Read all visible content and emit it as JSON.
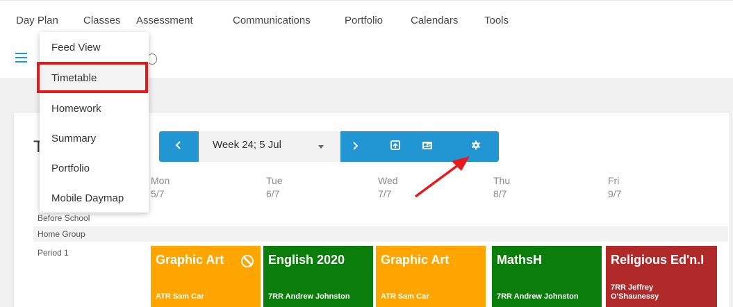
{
  "top_nav": [
    "Day Plan",
    "Classes",
    "Assessment",
    "Communications",
    "Portfolio",
    "Calendars",
    "Tools"
  ],
  "menu": {
    "items": [
      "Feed View",
      "Timetable",
      "Homework",
      "Summary",
      "Portfolio",
      "Mobile Daymap"
    ],
    "highlighted": "Timetable"
  },
  "card": {
    "title_fragment": "T"
  },
  "week_bar": {
    "selected_week": "Week 24; 5 Jul",
    "accent": "#2196d3"
  },
  "days": [
    {
      "name": "Mon",
      "date": "5/7"
    },
    {
      "name": "Tue",
      "date": "6/7"
    },
    {
      "name": "Wed",
      "date": "7/7"
    },
    {
      "name": "Thu",
      "date": "8/7"
    },
    {
      "name": "Fri",
      "date": "9/7"
    }
  ],
  "rows": [
    "Before School",
    "Home Group",
    "Period 1"
  ],
  "period1": [
    {
      "subject": "Graphic Art",
      "teacher": "ATR Sam Car",
      "color": "#ffa500",
      "icon": "ban-icon"
    },
    {
      "subject": "English 2020",
      "teacher": "7RR Andrew Johnston",
      "color": "#0a7d0a"
    },
    {
      "subject": "Graphic Art",
      "teacher": "ATR Sam Car",
      "color": "#ffa500"
    },
    {
      "subject": "MathsH",
      "teacher": "7RR Andrew Johnston",
      "color": "#0a7d0a"
    },
    {
      "subject": "Religious Ed'n.I",
      "teacher": "7RR Jeffrey O'Shaunessy",
      "color": "#b02a2a"
    }
  ],
  "annotation_colors": {
    "box": "#e8191a",
    "arrow": "#e8191a"
  }
}
